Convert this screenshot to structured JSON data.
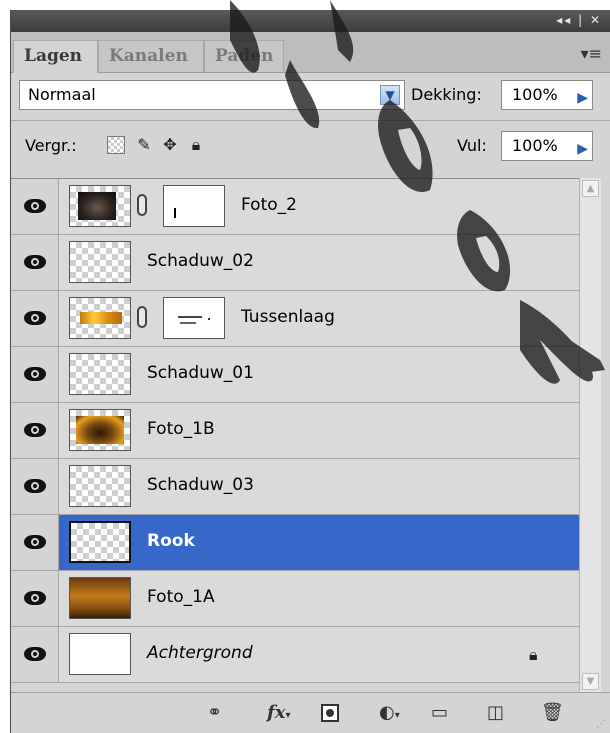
{
  "tabs": [
    "Lagen",
    "Kanalen",
    "Paden"
  ],
  "titlebar_controls": "◂◂ | ✕",
  "blend_mode": "Normaal",
  "opacity_label": "Dekking:",
  "opacity_value": "100%",
  "lock_label": "Vergr.:",
  "fill_label": "Vul:",
  "fill_value": "100%",
  "layers": [
    {
      "name": "Foto_2",
      "thumb": "face",
      "mask": true
    },
    {
      "name": "Schaduw_02",
      "thumb": "transparent"
    },
    {
      "name": "Tussenlaag",
      "thumb": "fire",
      "mask": true
    },
    {
      "name": "Schaduw_01",
      "thumb": "transparent"
    },
    {
      "name": "Foto_1B",
      "thumb": "fire2"
    },
    {
      "name": "Schaduw_03",
      "thumb": "transparent"
    },
    {
      "name": "Rook",
      "thumb": "transparent",
      "selected": true
    },
    {
      "name": "Foto_1A",
      "thumb": "fire3"
    },
    {
      "name": "Achtergrond",
      "thumb": "white",
      "locked": true
    }
  ],
  "bottom_icons": [
    "link-layers-icon",
    "fx-icon",
    "add-mask-icon",
    "adjustment-layer-icon",
    "group-folder-icon",
    "new-layer-icon",
    "trash-icon"
  ],
  "colors": {
    "selected": "#3767c8",
    "panel": "#d4d4d4",
    "titlebar": "#3c3c3c"
  }
}
